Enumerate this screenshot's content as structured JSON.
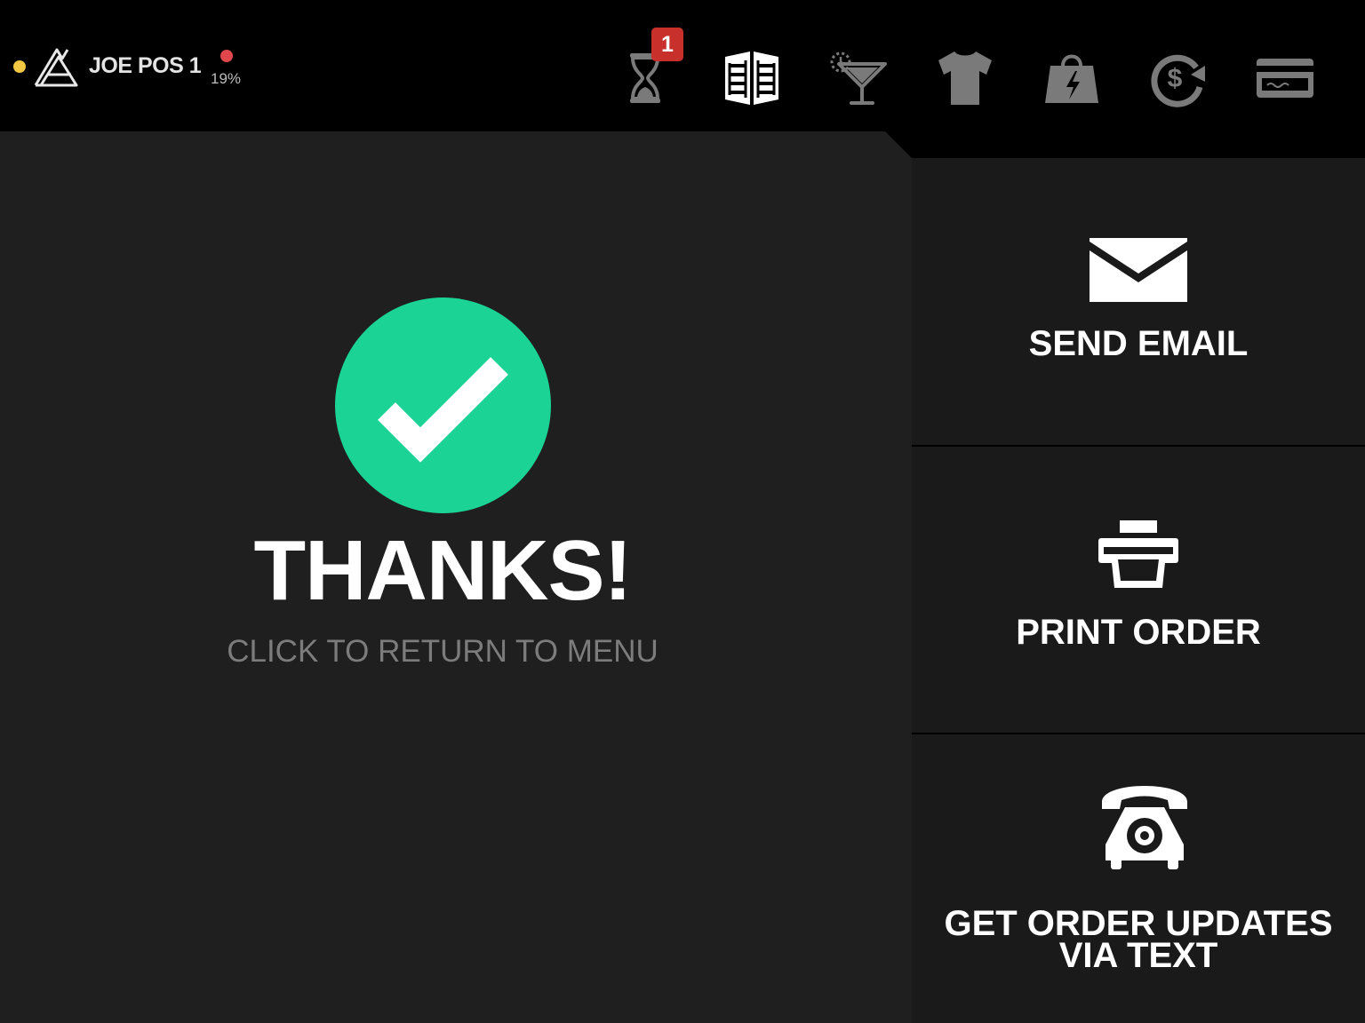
{
  "header": {
    "device_name": "JOE POS 1",
    "battery_percent": "19%",
    "pending_badge_count": "1",
    "nav_icons": [
      "hourglass-icon",
      "menu-book-icon",
      "happy-hour-cocktail-icon",
      "tshirt-icon",
      "quick-bag-icon",
      "refund-icon",
      "credit-card-icon"
    ]
  },
  "main": {
    "title": "THANKS!",
    "subtitle": "CLICK TO RETURN TO MENU",
    "success_icon": "checkmark-circle-icon"
  },
  "actions": {
    "email": {
      "label": "SEND EMAIL",
      "icon": "envelope-icon"
    },
    "print": {
      "label": "PRINT ORDER",
      "icon": "printer-icon"
    },
    "text": {
      "label_line1": "GET ORDER UPDATES",
      "label_line2": "VIA TEXT",
      "icon": "telephone-icon"
    }
  },
  "colors": {
    "success_green": "#1bd394",
    "badge_red": "#c8312b",
    "status_yellow": "#f2c744",
    "battery_red": "#e0474c",
    "background": "#1f1f1f",
    "bar": "#000000"
  }
}
